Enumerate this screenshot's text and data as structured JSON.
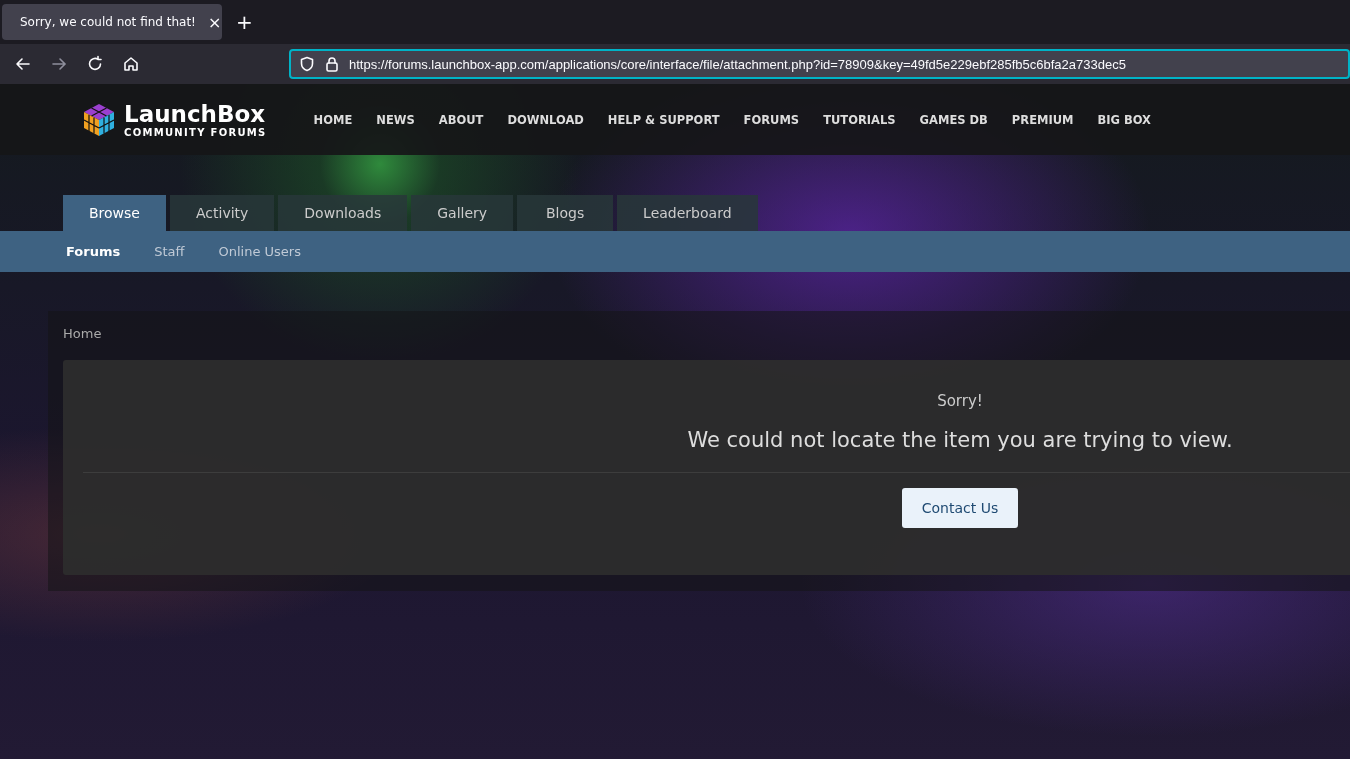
{
  "browser": {
    "tab_title": "Sorry, we could not find that!",
    "close": "×",
    "new_tab": "+",
    "url": "https://forums.launchbox-app.com/applications/core/interface/file/attachment.php?id=78909&key=49fd5e229ebf285fb5c6bfa2a733dec5"
  },
  "header": {
    "logo_title": "LaunchBox",
    "logo_subtitle": "COMMUNITY FORUMS",
    "nav": [
      "HOME",
      "NEWS",
      "ABOUT",
      "DOWNLOAD",
      "HELP & SUPPORT",
      "FORUMS",
      "TUTORIALS",
      "GAMES DB",
      "PREMIUM",
      "BIG BOX"
    ]
  },
  "tabs": [
    {
      "label": "Browse",
      "selected": true
    },
    {
      "label": "Activity",
      "selected": false
    },
    {
      "label": "Downloads",
      "selected": false
    },
    {
      "label": "Gallery",
      "selected": false
    },
    {
      "label": "Blogs",
      "selected": false
    },
    {
      "label": "Leaderboard",
      "selected": false
    }
  ],
  "subnav": [
    {
      "label": "Forums",
      "selected": true
    },
    {
      "label": "Staff",
      "selected": false
    },
    {
      "label": "Online Users",
      "selected": false
    }
  ],
  "breadcrumb": [
    "Home"
  ],
  "error": {
    "heading": "Sorry!",
    "message": "We could not locate the item you are trying to view.",
    "button": "Contact Us"
  }
}
